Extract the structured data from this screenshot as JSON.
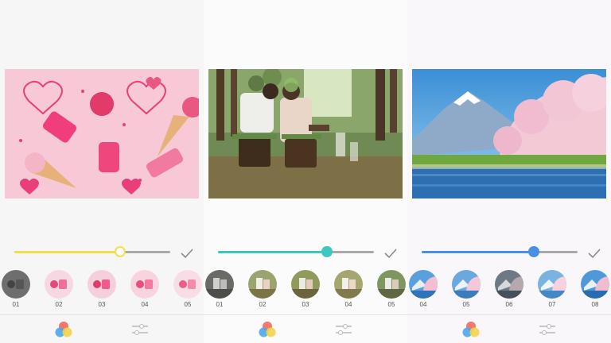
{
  "panels": [
    {
      "accent": "#f2e04a",
      "slider": {
        "value": 0.68
      },
      "filters": [
        {
          "label": "01"
        },
        {
          "label": "02"
        },
        {
          "label": "03"
        },
        {
          "label": "04"
        },
        {
          "label": "05"
        }
      ]
    },
    {
      "accent": "#3ec6c0",
      "slider": {
        "value": 0.7
      },
      "filters": [
        {
          "label": "01"
        },
        {
          "label": "02"
        },
        {
          "label": "03"
        },
        {
          "label": "04"
        },
        {
          "label": "05"
        }
      ]
    },
    {
      "accent": "#4a90e2",
      "slider": {
        "value": 0.72
      },
      "filters": [
        {
          "label": "04"
        },
        {
          "label": "05"
        },
        {
          "label": "06"
        },
        {
          "label": "07"
        },
        {
          "label": "08"
        }
      ]
    }
  ],
  "icons": {
    "confirm": "check-icon",
    "palette": "color-filter-icon",
    "adjust": "adjust-sliders-icon"
  }
}
